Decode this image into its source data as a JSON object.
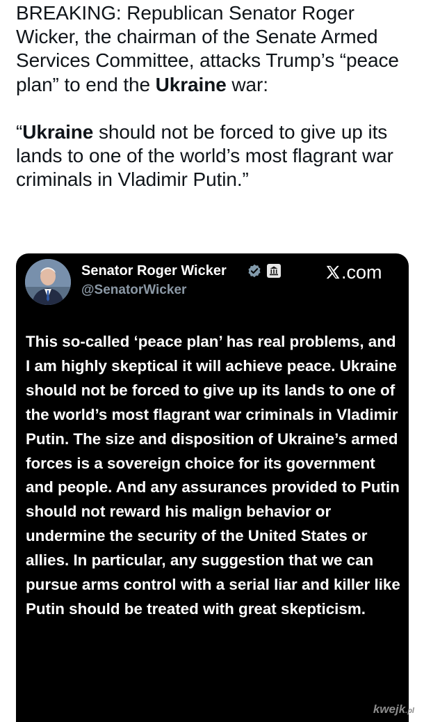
{
  "post": {
    "paragraph1": {
      "before": "BREAKING: Republican Senator Roger Wicker, the chairman of the Senate Armed Services Committee, attacks Trump’s “peace plan” to end the ",
      "bold": "Ukraine",
      "after": " war:"
    },
    "paragraph2": {
      "before": "“",
      "bold": "Ukraine",
      "after": " should not be forced to give up its lands to one of the world’s most flagrant war criminals in Vladimir Putin.”"
    }
  },
  "tweet": {
    "author_name": "Senator Roger Wicker",
    "handle": "@SenatorWicker",
    "source_label": ".com",
    "body": "This so-called ‘peace plan’ has real problems, and I am highly skeptical it will achieve peace. Ukraine should not be forced to give up its lands to one of the world’s most flagrant war criminals in Vladimir Putin. The size and disposition of Ukraine’s armed forces is a sovereign choice for its government and people. And any assurances provided to Putin should not reward his malign behavior or undermine the security of the United States or allies. In particular, any suggestion that we can pursue arms control with a serial liar and killer like Putin should be treated with great skepticism.",
    "icons": {
      "verified": "verified-badge-icon",
      "government": "government-building-icon",
      "source_logo": "x-logo-icon"
    }
  },
  "watermark": {
    "text": "kwejk",
    "suffix": ".pl"
  },
  "colors": {
    "page_bg": "#ffffff",
    "card_bg": "#000000",
    "text_dark": "#0f1419",
    "handle_gray": "#8b98a5",
    "verified_gray": "#829aab"
  }
}
